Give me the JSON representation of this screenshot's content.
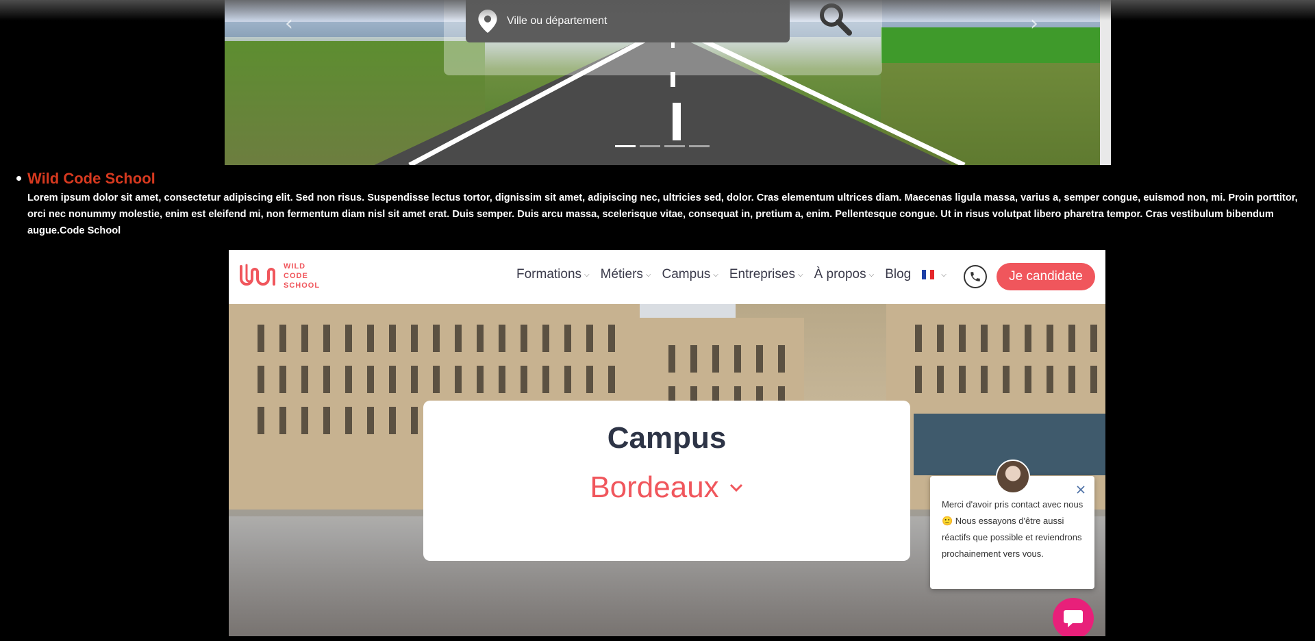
{
  "carousel": {
    "search_placeholder": "Ville ou département",
    "prev_label": "‹",
    "next_label": "›",
    "indicator_count": 4,
    "active_indicator": 0
  },
  "info": {
    "title": "Wild Code School",
    "text": "Lorem ipsum dolor sit amet, consectetur adipiscing elit. Sed non risus. Suspendisse lectus tortor, dignissim sit amet, adipiscing nec, ultricies sed, dolor. Cras elementum ultrices diam. Maecenas ligula massa, varius a, semper congue, euismod non, mi. Proin porttitor, orci nec nonummy molestie, enim est eleifend mi, non fermentum diam nisl sit amet erat. Duis semper. Duis arcu massa, scelerisque vitae, consequat in, pretium a, enim. Pellentesque congue. Ut in risus volutpat libero pharetra tempor. Cras vestibulum bibendum augue.Code School"
  },
  "site": {
    "logo_line1": "WILD",
    "logo_line2": "CODE",
    "logo_line3": "SCHOOL",
    "nav": {
      "formations": "Formations",
      "metiers": "Métiers",
      "campus": "Campus",
      "entreprises": "Entreprises",
      "apropos": "À propos",
      "blog": "Blog"
    },
    "cta_label": "Je candidate",
    "hero": {
      "title": "Campus",
      "city": "Bordeaux"
    },
    "chat": {
      "message": "Merci d'avoir pris contact avec nous 🙂 Nous essayons d'être aussi réactifs que possible et reviendrons prochainement vers vous."
    }
  },
  "colors": {
    "brand": "#f0565c",
    "title_red": "#d6391f",
    "chat_launcher": "#e8207a"
  }
}
